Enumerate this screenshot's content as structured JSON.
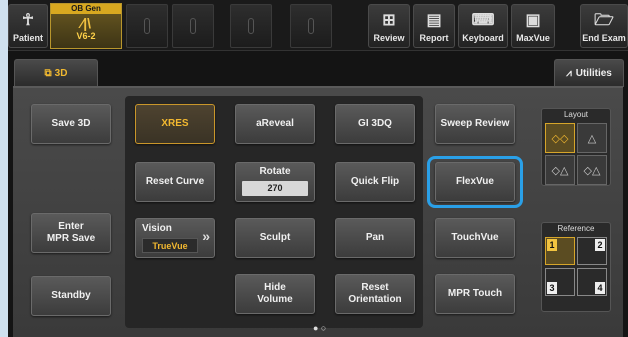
{
  "topbar": {
    "patient_label": "Patient",
    "probe": {
      "header": "OB Gen",
      "name": "V6-2"
    },
    "review_label": "Review",
    "report_label": "Report",
    "keyboard_label": "Keyboard",
    "maxvue_label": "MaxVue",
    "end_exam_label": "End Exam"
  },
  "tabs": {
    "active": "3D",
    "utilities": "Utilities"
  },
  "buttons": {
    "save_3d": "Save 3D",
    "xres": "XRES",
    "areveal": "aReveal",
    "gi_3dq": "GI 3DQ",
    "sweep_review": "Sweep Review",
    "reset_curve": "Reset Curve",
    "rotate": {
      "label": "Rotate",
      "value": "270"
    },
    "quick_flip": "Quick Flip",
    "flexvue": "FlexVue",
    "enter_mpr_save": "Enter\nMPR Save",
    "vision": {
      "label": "Vision",
      "value": "TrueVue"
    },
    "sculpt": "Sculpt",
    "pan": "Pan",
    "touchvue": "TouchVue",
    "standby": "Standby",
    "hide_volume": "Hide\nVolume",
    "reset_orientation": "Reset\nOrientation",
    "mpr_touch": "MPR Touch"
  },
  "layout_group": {
    "title": "Layout"
  },
  "reference_group": {
    "title": "Reference",
    "cells": [
      "1",
      "2",
      "3",
      "4"
    ],
    "selected": "1"
  },
  "pager": "● ○",
  "colors": {
    "accent": "#f2b830",
    "highlight": "#2aa0e8"
  }
}
